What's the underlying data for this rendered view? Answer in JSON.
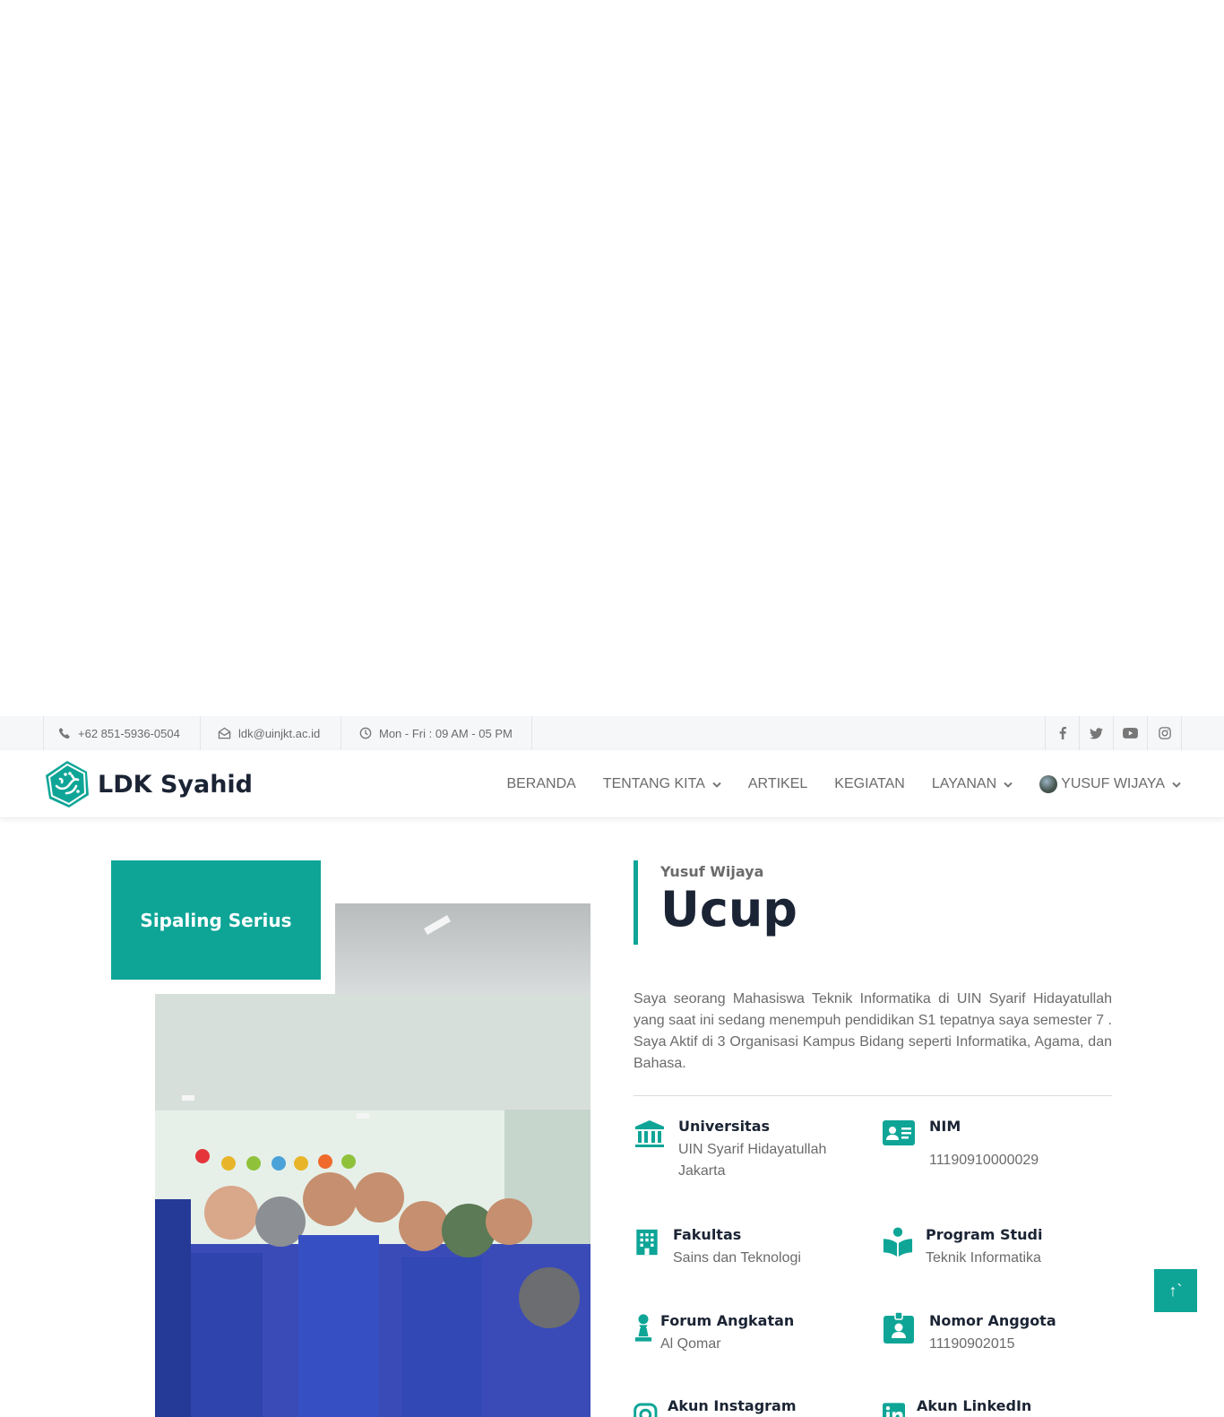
{
  "topbar": {
    "phone": "+62 851-5936-0504",
    "email": "ldk@uinjkt.ac.id",
    "hours": "Mon - Fri : 09 AM - 05 PM",
    "socials": [
      "facebook-icon",
      "twitter-icon",
      "youtube-icon",
      "instagram-icon"
    ]
  },
  "brand": {
    "name": "LDK Syahid"
  },
  "nav": {
    "items": [
      {
        "label": "BERANDA",
        "dropdown": false
      },
      {
        "label": "TENTANG KITA",
        "dropdown": true
      },
      {
        "label": "ARTIKEL",
        "dropdown": false
      },
      {
        "label": "KEGIATAN",
        "dropdown": false
      },
      {
        "label": "LAYANAN",
        "dropdown": true
      }
    ],
    "user": "YUSUF WIJAYA"
  },
  "profile": {
    "tag": "Sipaling Serius",
    "full_name": "Yusuf Wijaya",
    "nickname": "Ucup",
    "bio": "Saya seorang Mahasiswa Teknik Informatika di UIN Syarif Hidayatullah yang saat ini sedang menempuh pendidikan S1 tepatnya saya semester 7 . Saya Aktif di 3 Organisasi Kampus Bidang seperti Informatika, Agama, dan Bahasa.",
    "fields": {
      "universitas": {
        "label": "Universitas",
        "value": "UIN Syarif Hidayatullah Jakarta"
      },
      "nim": {
        "label": "NIM",
        "value": "11190910000029"
      },
      "fakultas": {
        "label": "Fakultas",
        "value": "Sains dan Teknologi"
      },
      "prodi": {
        "label": "Program Studi",
        "value": "Teknik Informatika"
      },
      "forum": {
        "label": "Forum Angkatan",
        "value": "Al Qomar"
      },
      "nomor": {
        "label": "Nomor Anggota",
        "value": "11190902015"
      },
      "instagram": {
        "label": "Akun Instagram",
        "value": ""
      },
      "linkedin": {
        "label": "Akun LinkedIn",
        "value": ""
      }
    }
  },
  "to_top": {
    "label": "↑`"
  },
  "colors": {
    "accent": "#0ea597",
    "dark": "#1b2434",
    "text": "#6b6b6b"
  }
}
